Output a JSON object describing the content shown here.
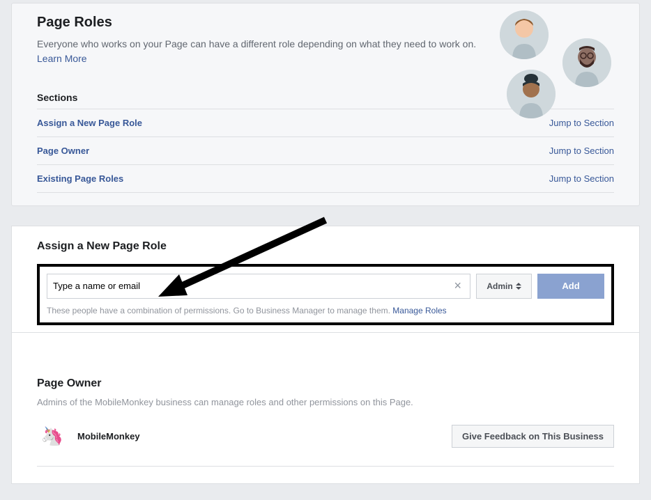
{
  "header": {
    "title": "Page Roles",
    "subtitle": "Everyone who works on your Page can have a different role depending on what they need to work on.",
    "learn_more": "Learn More"
  },
  "sections": {
    "heading": "Sections",
    "jump_label": "Jump to Section",
    "items": [
      {
        "label": "Assign a New Page Role"
      },
      {
        "label": "Page Owner"
      },
      {
        "label": "Existing Page Roles"
      }
    ]
  },
  "assign": {
    "heading": "Assign a New Page Role",
    "input_value": "Type a name or email",
    "role_label": "Admin",
    "add_label": "Add",
    "helper_text": "These people have a combination of permissions. Go to Business Manager to manage them. ",
    "manage_roles": "Manage Roles"
  },
  "owner": {
    "heading": "Page Owner",
    "description": "Admins of the MobileMonkey business can manage roles and other permissions on this Page.",
    "name": "MobileMonkey",
    "feedback_label": "Give Feedback on This Business"
  }
}
